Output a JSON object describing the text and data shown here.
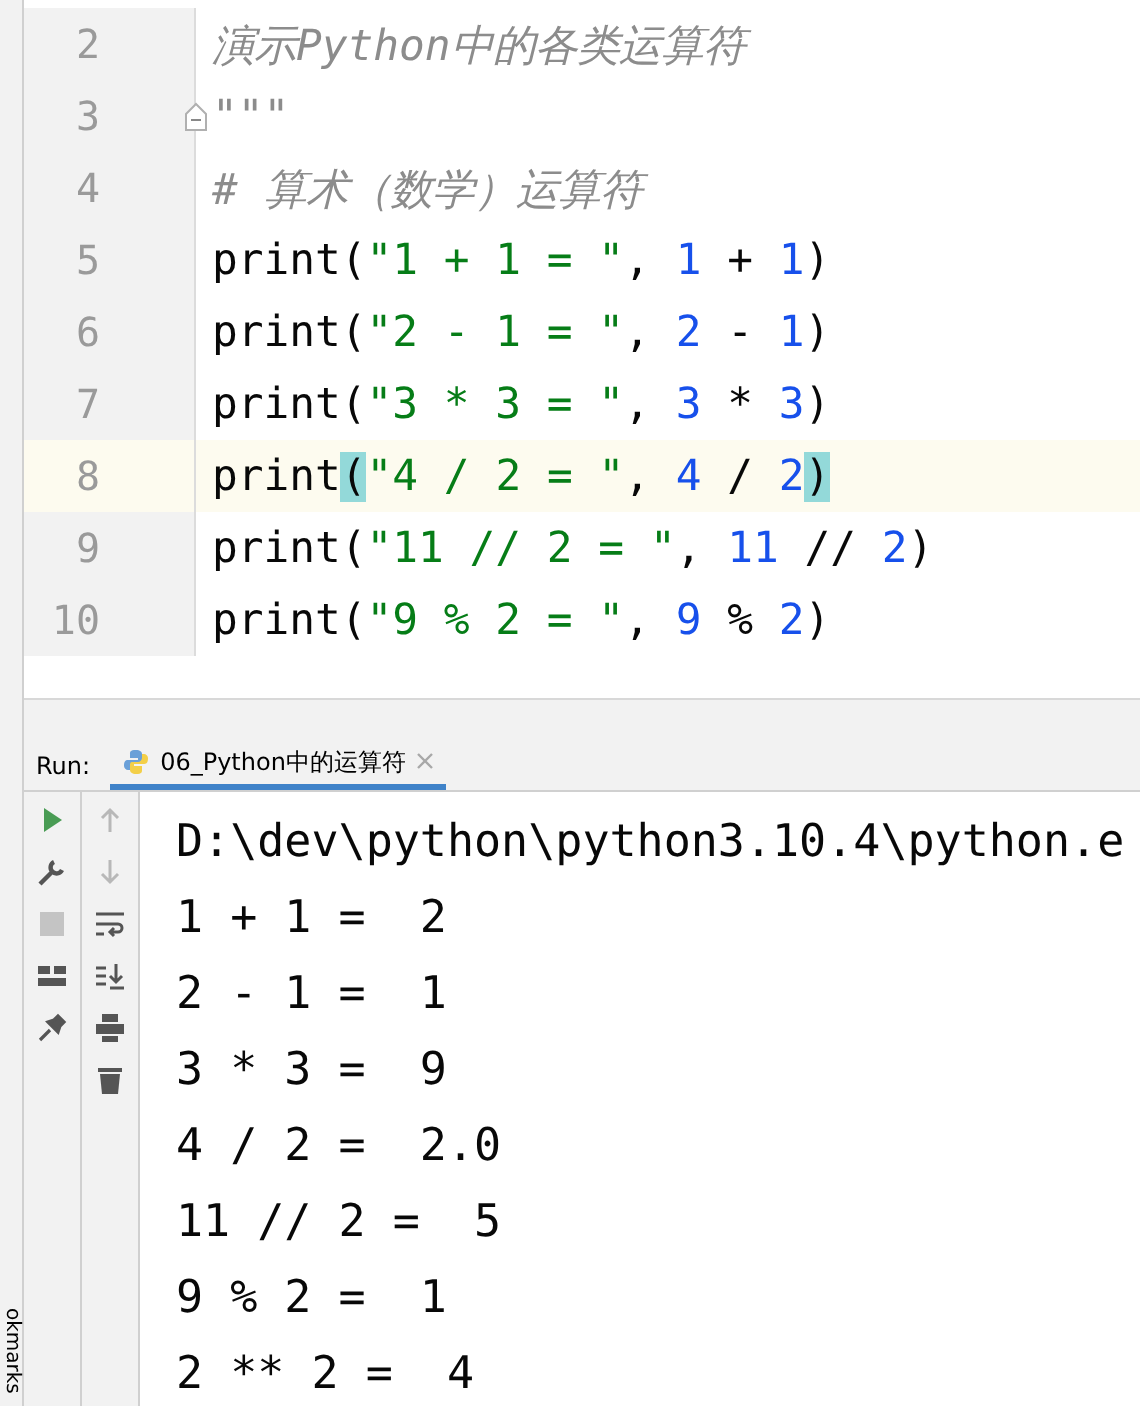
{
  "editor": {
    "lines": [
      {
        "number": "2",
        "current": false,
        "fold": false,
        "tokens": [
          {
            "kind": "doc",
            "text": "演示Python中的各类运算符"
          }
        ]
      },
      {
        "number": "3",
        "current": false,
        "fold": true,
        "tokens": [
          {
            "kind": "doc",
            "text": "\"\"\""
          }
        ]
      },
      {
        "number": "4",
        "current": false,
        "fold": false,
        "tokens": [
          {
            "kind": "comment",
            "text": "# 算术（数学）运算符"
          }
        ]
      },
      {
        "number": "5",
        "current": false,
        "fold": false,
        "tokens": [
          {
            "kind": "plain",
            "text": "print("
          },
          {
            "kind": "str",
            "text": "\"1 + 1 = \""
          },
          {
            "kind": "plain",
            "text": ", "
          },
          {
            "kind": "num",
            "text": "1"
          },
          {
            "kind": "plain",
            "text": " + "
          },
          {
            "kind": "num",
            "text": "1"
          },
          {
            "kind": "plain",
            "text": ")"
          }
        ]
      },
      {
        "number": "6",
        "current": false,
        "fold": false,
        "tokens": [
          {
            "kind": "plain",
            "text": "print("
          },
          {
            "kind": "str",
            "text": "\"2 - 1 = \""
          },
          {
            "kind": "plain",
            "text": ", "
          },
          {
            "kind": "num",
            "text": "2"
          },
          {
            "kind": "plain",
            "text": " - "
          },
          {
            "kind": "num",
            "text": "1"
          },
          {
            "kind": "plain",
            "text": ")"
          }
        ]
      },
      {
        "number": "7",
        "current": false,
        "fold": false,
        "tokens": [
          {
            "kind": "plain",
            "text": "print("
          },
          {
            "kind": "str",
            "text": "\"3 * 3 = \""
          },
          {
            "kind": "plain",
            "text": ", "
          },
          {
            "kind": "num",
            "text": "3"
          },
          {
            "kind": "plain",
            "text": " * "
          },
          {
            "kind": "num",
            "text": "3"
          },
          {
            "kind": "plain",
            "text": ")"
          }
        ]
      },
      {
        "number": "8",
        "current": true,
        "fold": false,
        "tokens": [
          {
            "kind": "plain",
            "text": "print"
          },
          {
            "kind": "match",
            "text": "("
          },
          {
            "kind": "str",
            "text": "\"4 / 2 = \""
          },
          {
            "kind": "plain",
            "text": ", "
          },
          {
            "kind": "num",
            "text": "4"
          },
          {
            "kind": "plain",
            "text": " / "
          },
          {
            "kind": "num",
            "text": "2"
          },
          {
            "kind": "match",
            "text": ")"
          }
        ]
      },
      {
        "number": "9",
        "current": false,
        "fold": false,
        "tokens": [
          {
            "kind": "plain",
            "text": "print("
          },
          {
            "kind": "str",
            "text": "\"11 // 2 = \""
          },
          {
            "kind": "plain",
            "text": ", "
          },
          {
            "kind": "num",
            "text": "11"
          },
          {
            "kind": "plain",
            "text": " // "
          },
          {
            "kind": "num",
            "text": "2"
          },
          {
            "kind": "plain",
            "text": ")"
          }
        ]
      },
      {
        "number": "10",
        "current": false,
        "fold": false,
        "tokens": [
          {
            "kind": "plain",
            "text": "print("
          },
          {
            "kind": "str",
            "text": "\"9 % 2 = \""
          },
          {
            "kind": "plain",
            "text": ", "
          },
          {
            "kind": "num",
            "text": "9"
          },
          {
            "kind": "plain",
            "text": " % "
          },
          {
            "kind": "num",
            "text": "2"
          },
          {
            "kind": "plain",
            "text": ")"
          }
        ]
      }
    ]
  },
  "run_panel": {
    "label": "Run:",
    "tabs": [
      {
        "label": "06_Python中的运算符",
        "selected": true
      }
    ],
    "left_toolbar": [
      {
        "kind": "run"
      },
      {
        "kind": "wrench"
      },
      {
        "kind": "stop"
      },
      {
        "kind": "layout"
      },
      {
        "kind": "pin"
      }
    ],
    "right_toolbar": [
      {
        "kind": "up"
      },
      {
        "kind": "down"
      },
      {
        "kind": "wrap"
      },
      {
        "kind": "scroll-end"
      },
      {
        "kind": "print"
      },
      {
        "kind": "trash"
      }
    ],
    "output": [
      "D:\\dev\\python\\python3.10.4\\python.e",
      "1 + 1 =  2",
      "2 - 1 =  1",
      "3 * 3 =  9",
      "4 / 2 =  2.0",
      "11 // 2 =  5",
      "9 % 2 =  1",
      "2 ** 2 =  4"
    ]
  },
  "side_tab": "okmarks"
}
